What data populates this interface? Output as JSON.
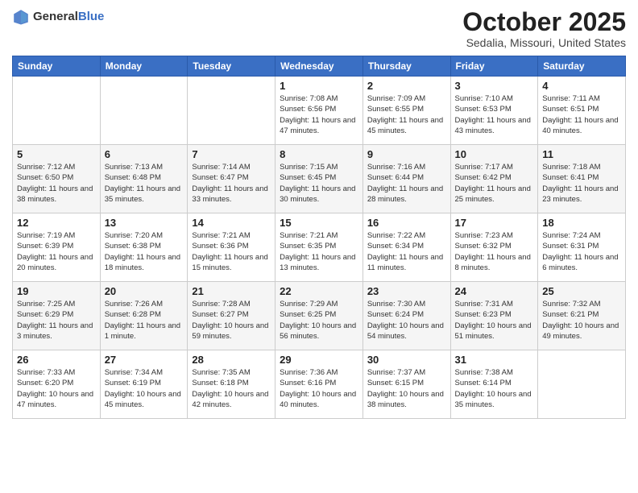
{
  "header": {
    "logo_general": "General",
    "logo_blue": "Blue",
    "title": "October 2025",
    "subtitle": "Sedalia, Missouri, United States"
  },
  "days_of_week": [
    "Sunday",
    "Monday",
    "Tuesday",
    "Wednesday",
    "Thursday",
    "Friday",
    "Saturday"
  ],
  "weeks": [
    [
      {
        "day": "",
        "info": ""
      },
      {
        "day": "",
        "info": ""
      },
      {
        "day": "",
        "info": ""
      },
      {
        "day": "1",
        "info": "Sunrise: 7:08 AM\nSunset: 6:56 PM\nDaylight: 11 hours and 47 minutes."
      },
      {
        "day": "2",
        "info": "Sunrise: 7:09 AM\nSunset: 6:55 PM\nDaylight: 11 hours and 45 minutes."
      },
      {
        "day": "3",
        "info": "Sunrise: 7:10 AM\nSunset: 6:53 PM\nDaylight: 11 hours and 43 minutes."
      },
      {
        "day": "4",
        "info": "Sunrise: 7:11 AM\nSunset: 6:51 PM\nDaylight: 11 hours and 40 minutes."
      }
    ],
    [
      {
        "day": "5",
        "info": "Sunrise: 7:12 AM\nSunset: 6:50 PM\nDaylight: 11 hours and 38 minutes."
      },
      {
        "day": "6",
        "info": "Sunrise: 7:13 AM\nSunset: 6:48 PM\nDaylight: 11 hours and 35 minutes."
      },
      {
        "day": "7",
        "info": "Sunrise: 7:14 AM\nSunset: 6:47 PM\nDaylight: 11 hours and 33 minutes."
      },
      {
        "day": "8",
        "info": "Sunrise: 7:15 AM\nSunset: 6:45 PM\nDaylight: 11 hours and 30 minutes."
      },
      {
        "day": "9",
        "info": "Sunrise: 7:16 AM\nSunset: 6:44 PM\nDaylight: 11 hours and 28 minutes."
      },
      {
        "day": "10",
        "info": "Sunrise: 7:17 AM\nSunset: 6:42 PM\nDaylight: 11 hours and 25 minutes."
      },
      {
        "day": "11",
        "info": "Sunrise: 7:18 AM\nSunset: 6:41 PM\nDaylight: 11 hours and 23 minutes."
      }
    ],
    [
      {
        "day": "12",
        "info": "Sunrise: 7:19 AM\nSunset: 6:39 PM\nDaylight: 11 hours and 20 minutes."
      },
      {
        "day": "13",
        "info": "Sunrise: 7:20 AM\nSunset: 6:38 PM\nDaylight: 11 hours and 18 minutes."
      },
      {
        "day": "14",
        "info": "Sunrise: 7:21 AM\nSunset: 6:36 PM\nDaylight: 11 hours and 15 minutes."
      },
      {
        "day": "15",
        "info": "Sunrise: 7:21 AM\nSunset: 6:35 PM\nDaylight: 11 hours and 13 minutes."
      },
      {
        "day": "16",
        "info": "Sunrise: 7:22 AM\nSunset: 6:34 PM\nDaylight: 11 hours and 11 minutes."
      },
      {
        "day": "17",
        "info": "Sunrise: 7:23 AM\nSunset: 6:32 PM\nDaylight: 11 hours and 8 minutes."
      },
      {
        "day": "18",
        "info": "Sunrise: 7:24 AM\nSunset: 6:31 PM\nDaylight: 11 hours and 6 minutes."
      }
    ],
    [
      {
        "day": "19",
        "info": "Sunrise: 7:25 AM\nSunset: 6:29 PM\nDaylight: 11 hours and 3 minutes."
      },
      {
        "day": "20",
        "info": "Sunrise: 7:26 AM\nSunset: 6:28 PM\nDaylight: 11 hours and 1 minute."
      },
      {
        "day": "21",
        "info": "Sunrise: 7:28 AM\nSunset: 6:27 PM\nDaylight: 10 hours and 59 minutes."
      },
      {
        "day": "22",
        "info": "Sunrise: 7:29 AM\nSunset: 6:25 PM\nDaylight: 10 hours and 56 minutes."
      },
      {
        "day": "23",
        "info": "Sunrise: 7:30 AM\nSunset: 6:24 PM\nDaylight: 10 hours and 54 minutes."
      },
      {
        "day": "24",
        "info": "Sunrise: 7:31 AM\nSunset: 6:23 PM\nDaylight: 10 hours and 51 minutes."
      },
      {
        "day": "25",
        "info": "Sunrise: 7:32 AM\nSunset: 6:21 PM\nDaylight: 10 hours and 49 minutes."
      }
    ],
    [
      {
        "day": "26",
        "info": "Sunrise: 7:33 AM\nSunset: 6:20 PM\nDaylight: 10 hours and 47 minutes."
      },
      {
        "day": "27",
        "info": "Sunrise: 7:34 AM\nSunset: 6:19 PM\nDaylight: 10 hours and 45 minutes."
      },
      {
        "day": "28",
        "info": "Sunrise: 7:35 AM\nSunset: 6:18 PM\nDaylight: 10 hours and 42 minutes."
      },
      {
        "day": "29",
        "info": "Sunrise: 7:36 AM\nSunset: 6:16 PM\nDaylight: 10 hours and 40 minutes."
      },
      {
        "day": "30",
        "info": "Sunrise: 7:37 AM\nSunset: 6:15 PM\nDaylight: 10 hours and 38 minutes."
      },
      {
        "day": "31",
        "info": "Sunrise: 7:38 AM\nSunset: 6:14 PM\nDaylight: 10 hours and 35 minutes."
      },
      {
        "day": "",
        "info": ""
      }
    ]
  ]
}
